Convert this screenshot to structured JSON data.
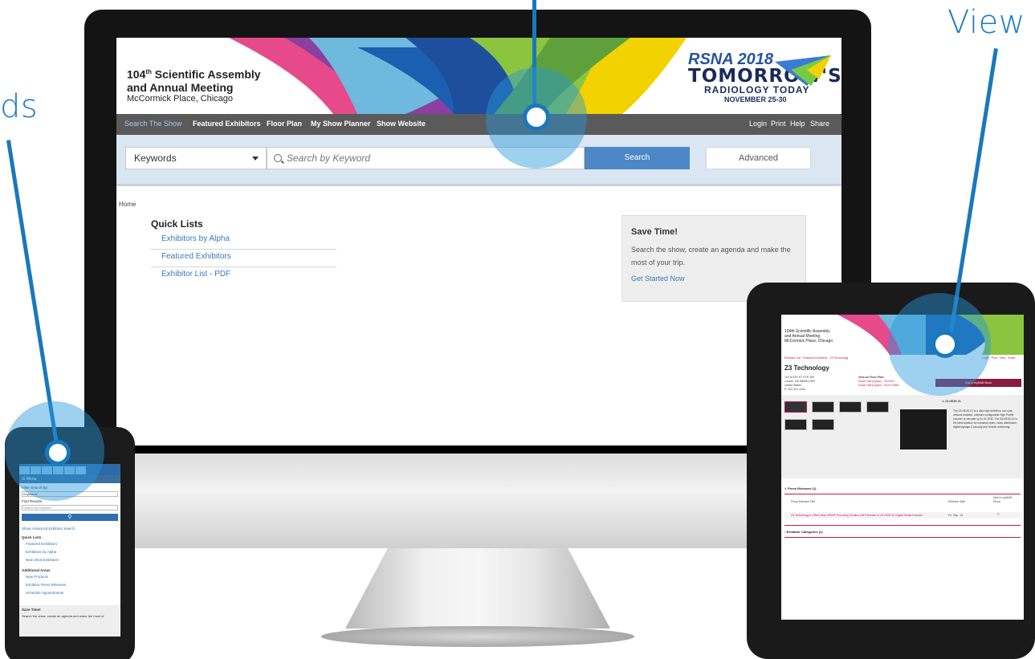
{
  "callouts": {
    "left_word": "ds",
    "right_word": "View"
  },
  "desktop": {
    "banner": {
      "title_prefix": "104",
      "title_sup": "th",
      "title_rest": " Scientific Assembly",
      "title_line2": "and Annual Meeting",
      "location": "McCormick Place, Chicago",
      "rsna": "RSNA 2018",
      "tagline1": "TOMORROW'S",
      "tagline2": "RADIOLOGY TODAY",
      "dates": "NOVEMBER 25-30"
    },
    "nav": {
      "items": [
        "Search The Show",
        "Featured Exhibitors",
        "Floor Plan",
        "My Show Planner",
        "Show Website"
      ],
      "right": [
        "Login",
        "Print",
        "Help",
        "Share"
      ]
    },
    "search": {
      "filter_value": "Keywords",
      "placeholder": "Search by Keyword",
      "search_label": "Search",
      "advanced_label": "Advanced"
    },
    "breadcrumb": "Home",
    "quick_lists": {
      "title": "Quick Lists",
      "items": [
        "Exhibitors by Alpha",
        "Featured Exhibitors",
        "Exhibitor List - PDF"
      ]
    },
    "save_time": {
      "title": "Save Time!",
      "text": "Search the show, create an agenda and make the most of your trip.",
      "link": "Get Started Now"
    }
  },
  "phone": {
    "menu": "Menu",
    "filter_label": "Filter Search By:",
    "filter_value": "Keywords",
    "find_label": "Find Results:",
    "placeholder": "Search by Keyword",
    "advanced_link": "Show Advanced Exhibitor Search",
    "quick_title": "Quick Lists",
    "quick_items": [
      "Featured Exhibitors",
      "Exhibitors by Alpha",
      "New 2015 Exhibitors"
    ],
    "areas_title": "Additional Areas",
    "areas_items": [
      "New Products",
      "Exhibitor Press Releases",
      "Schedule Appointments"
    ],
    "save_title": "Save Time!",
    "save_text": "Search the show, create an agenda and make the most of"
  },
  "tablet": {
    "title_line1": "104th Scientific Assembly",
    "title_line2": "and Annual Meeting",
    "location": "McCormick Place, Chicago",
    "breadcrumb": "Exhibitor List  ·  Featured Exhibitors  ·  Z3 Technology",
    "nav_right": "Login · Print · Help · Share",
    "company": "Z3 Technology",
    "address": [
      "100 N 8TH ST STE 250",
      "Lincoln, NE 68508-1369",
      "United States",
      "P: 402-441-1194"
    ],
    "floor_plan_title": "View on Floor Plan:",
    "floor_plan_items": [
      "South Hall (Upper) - SU1023",
      "South Hall (Upper) - SU1172MM"
    ],
    "add_button": "Add to myNAB Show",
    "product_name": "Z3-HE4K-01",
    "product_desc": "The Z3-HE4K-01 is a ultra high definition, low cost, network enabled, software configurable High Profile encoder or decoder up to 4K UHD. The Z3-HE4K-01 is the ideal solution for industrial video, video distribution, digital signage & security and remote monitoring.",
    "press_section": "Press Releases (1)",
    "press_headers": [
      "Press Release Title",
      "Release Date",
      "Add to myNAB Show"
    ],
    "press_row_title": "Z3 Technology's Offers New HDMI® Encoding Solution with Release of Z3-DME-03 Digital Media Encoder",
    "press_row_date": "Fri, Sep. 13",
    "categories_section": "Exhibitor Categories (1)"
  },
  "colors": {
    "accent_blue": "#1a78bd",
    "nav_gray": "#5a5a5a",
    "link_blue": "#3a78b8",
    "tablet_accent": "#c2185b"
  }
}
